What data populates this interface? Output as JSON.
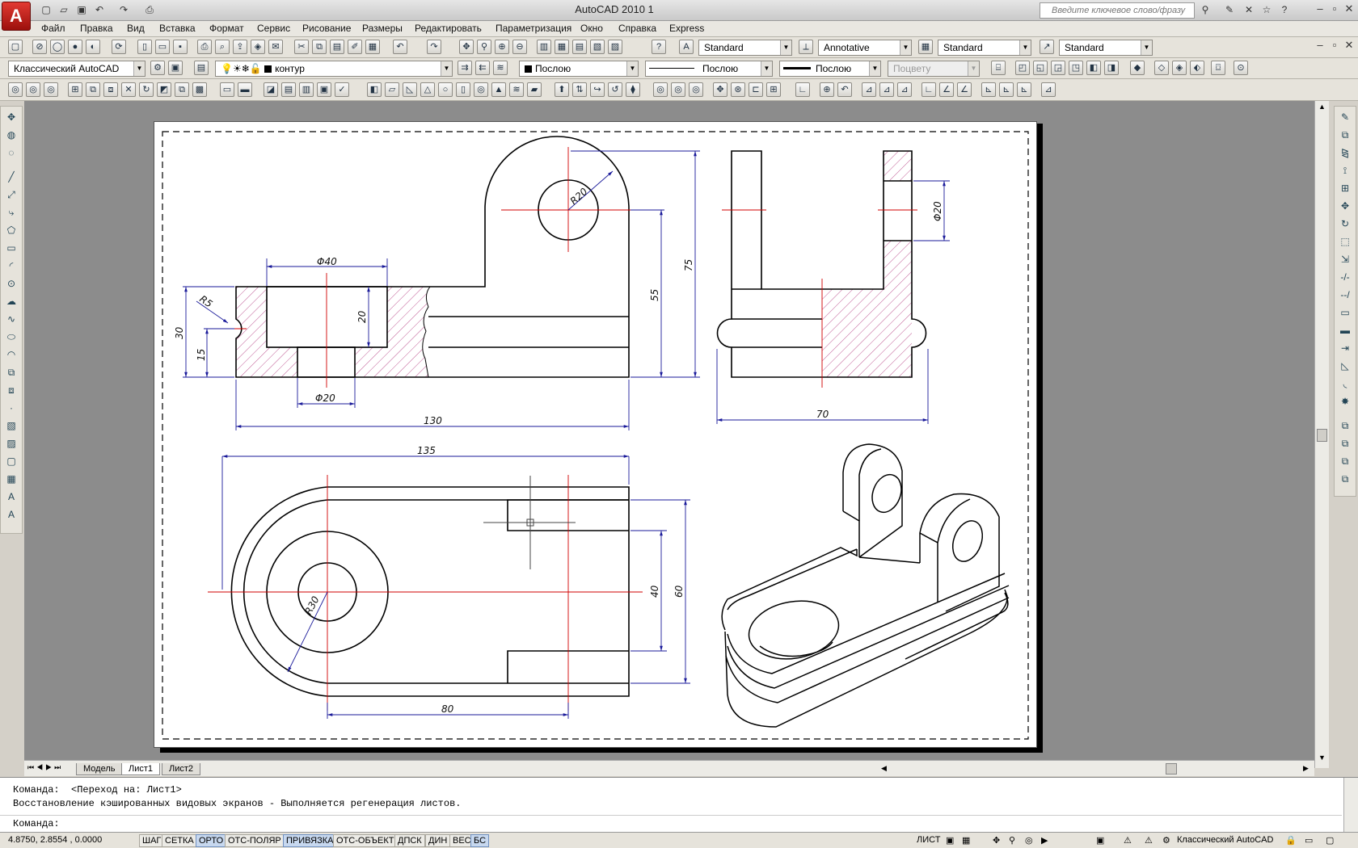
{
  "titlebar": {
    "app_logo": "A",
    "title": "AutoCAD 2010     1",
    "search_placeholder": "Введите ключевое слово/фразу"
  },
  "menu": [
    "Файл",
    "Правка",
    "Вид",
    "Вставка",
    "Формат",
    "Сервис",
    "Рисование",
    "Размеры",
    "Редактировать",
    "Параметризация",
    "Окно",
    "Справка",
    "Express"
  ],
  "styles_toolbar": {
    "text_style": "Standard",
    "annotative_style": "Annotative",
    "table_style": "Standard",
    "multileader_style": "Standard"
  },
  "layers_toolbar": {
    "workspace": "Классический AutoCAD",
    "layer": "контур",
    "color": "Послою",
    "linetype": "Послою",
    "lineweight": "Послою",
    "plotstyle": "Поцвету"
  },
  "layout_tabs": [
    "Модель",
    "Лист1",
    "Лист2"
  ],
  "command": {
    "line1": "Команда:  <Переход на: Лист1>",
    "line2": "Восстановление кэшированных видовых экранов - Выполняется регенерация листов.",
    "prompt": "Команда:"
  },
  "status": {
    "coords": "4.8750,  2.8554 , 0.0000",
    "toggles": [
      "ШАГ",
      "СЕТКА",
      "ОРТО",
      "ОТС-ПОЛЯР",
      "ПРИВЯЗКА",
      "ОТС-ОБЪЕКТ",
      "ДПСК",
      "ДИН",
      "ВЕС",
      "БС"
    ],
    "active_toggles": [
      "ОРТО",
      "ПРИВЯЗКА",
      "БС"
    ],
    "space": "ЛИСТ",
    "workspace": "Классический AutoCAD"
  },
  "drawing": {
    "dims": {
      "d40": "Φ40",
      "d20_top": "Φ20",
      "d20_side": "Φ20",
      "r5": "R5",
      "r20": "R20",
      "r30": "R30",
      "h30": "30",
      "h15": "15",
      "h20": "20",
      "h55": "55",
      "h75": "75",
      "w130": "130",
      "w135": "135",
      "w70": "70",
      "w80": "80",
      "h40": "40",
      "h60": "60"
    }
  },
  "colors": {
    "object_line": "#000000",
    "center_line": "#d00000",
    "dimension": "#1a1a9a",
    "hatch": "#b0307a",
    "workspace_bg": "#8c8c8c"
  }
}
